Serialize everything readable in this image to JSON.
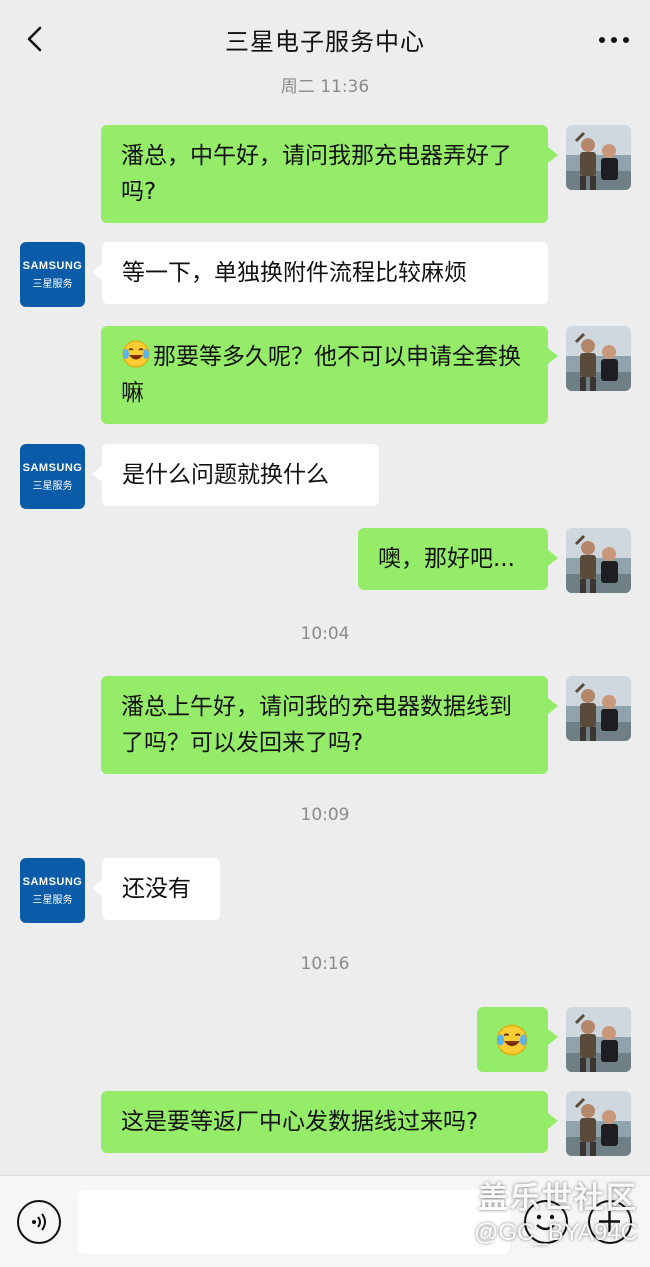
{
  "header": {
    "title": "三星电子服务中心",
    "back_icon": "chevron-left-icon",
    "more_icon": "more-dots-icon"
  },
  "contact_avatar": {
    "brand": "SAMSUNG",
    "label": "三星服务"
  },
  "messages": [
    {
      "type": "timestamp",
      "text": "周二 11:36"
    },
    {
      "type": "outgoing",
      "text": "潘总，中午好，请问我那充电器弄好了吗?"
    },
    {
      "type": "incoming",
      "text": "等一下，单独换附件流程比较麻烦"
    },
    {
      "type": "outgoing",
      "emoji": "face-with-tears-of-joy",
      "text": "那要等多久呢？他不可以申请全套换嘛"
    },
    {
      "type": "incoming",
      "text": "是什么问题就换什么"
    },
    {
      "type": "outgoing",
      "text": "噢，那好吧..."
    },
    {
      "type": "timestamp",
      "text": "10:04"
    },
    {
      "type": "outgoing",
      "text": "潘总上午好，请问我的充电器数据线到了吗？可以发回来了吗?"
    },
    {
      "type": "timestamp",
      "text": "10:09"
    },
    {
      "type": "incoming",
      "text": "还没有"
    },
    {
      "type": "timestamp",
      "text": "10:16"
    },
    {
      "type": "outgoing",
      "emoji": "face-with-tears-of-joy",
      "text": ""
    },
    {
      "type": "outgoing",
      "text": "这是要等返厂中心发数据线过来吗?"
    }
  ],
  "input_bar": {
    "voice_icon": "voice-icon",
    "emoji_icon": "emoji-icon",
    "plus_icon": "plus-icon",
    "value": ""
  },
  "watermark": {
    "line1": "盖乐世社区",
    "line2": "@GC_BYA94C"
  },
  "colors": {
    "outgoing_bubble": "#95ec69",
    "incoming_bubble": "#ffffff",
    "background": "#ededed",
    "samsung_blue": "#0a5ba8"
  }
}
